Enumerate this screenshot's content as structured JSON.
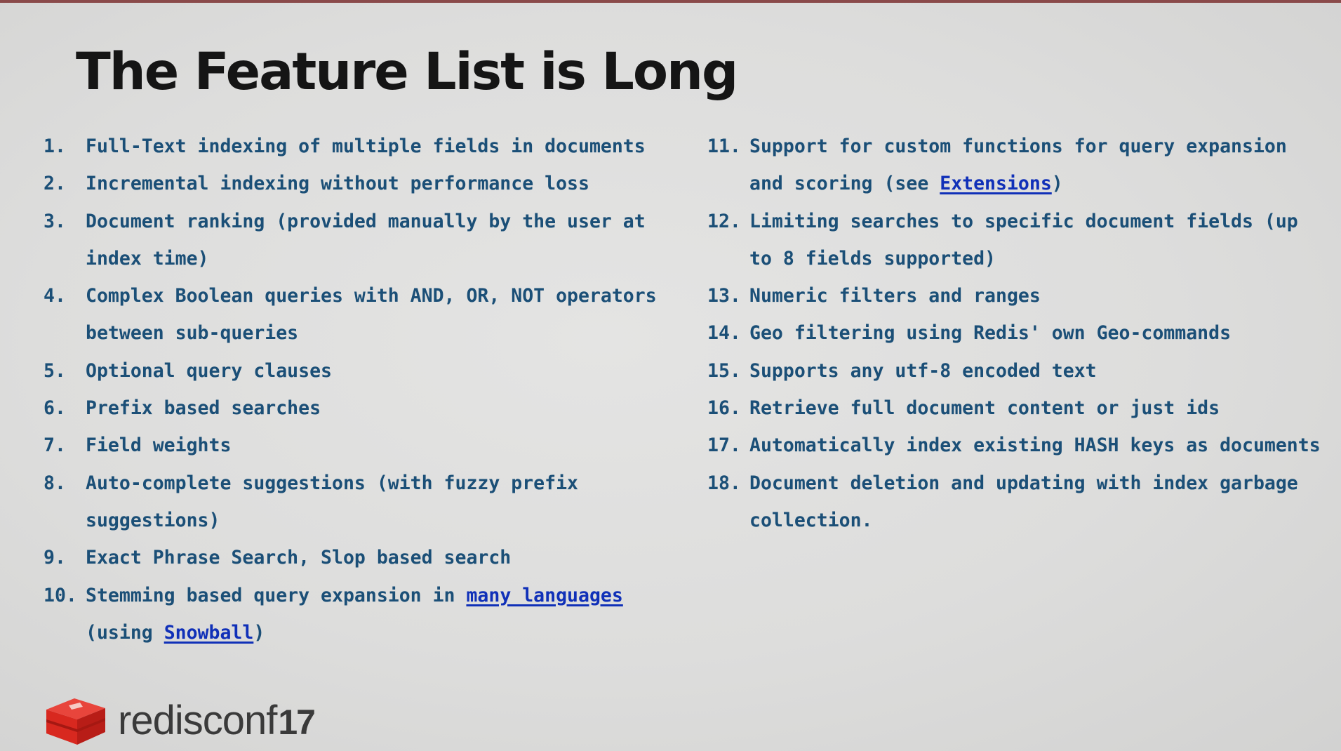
{
  "title": "The Feature List is Long",
  "left_items": [
    {
      "num": "1.",
      "parts": [
        {
          "text": "Full-Text indexing of multiple fields in documents"
        }
      ]
    },
    {
      "num": "2.",
      "parts": [
        {
          "text": "Incremental indexing without performance loss"
        }
      ]
    },
    {
      "num": "3.",
      "parts": [
        {
          "text": "Document ranking (provided manually by the user at index time)"
        }
      ]
    },
    {
      "num": "4.",
      "parts": [
        {
          "text": "Complex Boolean queries with AND, OR, NOT operators between sub-queries"
        }
      ]
    },
    {
      "num": "5.",
      "parts": [
        {
          "text": "Optional query clauses"
        }
      ]
    },
    {
      "num": "6.",
      "parts": [
        {
          "text": "Prefix based searches"
        }
      ]
    },
    {
      "num": "7.",
      "parts": [
        {
          "text": "Field weights"
        }
      ]
    },
    {
      "num": "8.",
      "parts": [
        {
          "text": "Auto-complete suggestions (with fuzzy prefix suggestions)"
        }
      ]
    },
    {
      "num": "9.",
      "parts": [
        {
          "text": "Exact Phrase Search, Slop based search"
        }
      ]
    },
    {
      "num": "10.",
      "parts": [
        {
          "text": "Stemming based query expansion in "
        },
        {
          "text": "many languages",
          "link": true
        },
        {
          "text": " (using "
        },
        {
          "text": "Snowball",
          "link": true
        },
        {
          "text": ")"
        }
      ]
    }
  ],
  "right_items": [
    {
      "num": "11.",
      "parts": [
        {
          "text": "Support for custom functions for query expansion and scoring (see "
        },
        {
          "text": "Extensions",
          "link": true
        },
        {
          "text": ")"
        }
      ]
    },
    {
      "num": "12.",
      "parts": [
        {
          "text": "Limiting searches to specific document fields (up to 8 fields supported)"
        }
      ]
    },
    {
      "num": "13.",
      "parts": [
        {
          "text": "Numeric filters and ranges"
        }
      ]
    },
    {
      "num": "14.",
      "parts": [
        {
          "text": "Geo filtering using Redis' own Geo-commands"
        }
      ]
    },
    {
      "num": "15.",
      "parts": [
        {
          "text": "Supports any utf-8 encoded text"
        }
      ]
    },
    {
      "num": "16.",
      "parts": [
        {
          "text": "Retrieve full document content or just ids"
        }
      ]
    },
    {
      "num": "17.",
      "parts": [
        {
          "text": "Automatically index existing HASH keys as documents"
        }
      ]
    },
    {
      "num": "18.",
      "parts": [
        {
          "text": "Document deletion and updating with index garbage collection."
        }
      ]
    }
  ],
  "logo": {
    "icon": "redis-cube-icon",
    "word": "redisconf",
    "year": "17",
    "colors": {
      "cube_top": "#e8453c",
      "cube_side": "#c0201a",
      "cube_front": "#d8281f",
      "text": "#3a3a3a"
    }
  },
  "colors": {
    "background": "#dddddc",
    "title": "#151515",
    "item_text": "#1b4f77",
    "link": "#1030b8"
  }
}
